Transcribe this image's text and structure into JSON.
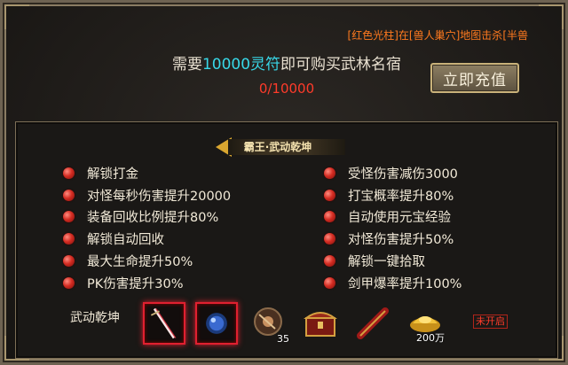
{
  "notice": {
    "item": "[红色光柱]",
    "text1": "在",
    "map": "[兽人巢穴]",
    "text2": "地图击杀",
    "boss": "[半兽"
  },
  "purchase": {
    "prefix": "需要",
    "amount": "10000灵符",
    "suffix": "即可购买武林名宿",
    "progress": "0/10000",
    "button_label": "立即充值"
  },
  "title": "霸王·武动乾坤",
  "benefits_left": [
    "解锁打金",
    "对怪每秒伤害提升20000",
    "装备回收比例提升80%",
    "解锁自动回收",
    "最大生命提升50%",
    "PK伤害提升30%"
  ],
  "benefits_right": [
    "受怪伤害减伤3000",
    "打宝概率提升80%",
    "自动使用元宝经验",
    "对怪伤害提升50%",
    "解锁一键拾取",
    "剑甲爆率提升100%"
  ],
  "set_label": "武动乾坤",
  "items": [
    {
      "icon": "sword-icon",
      "qty": ""
    },
    {
      "icon": "blue-orb-icon",
      "qty": ""
    },
    {
      "icon": "disc-icon",
      "qty": "35"
    },
    {
      "icon": "treasure-chest-icon",
      "qty": ""
    },
    {
      "icon": "scroll-icon",
      "qty": ""
    },
    {
      "icon": "gold-ingot-icon",
      "qty": "200万"
    }
  ],
  "status": "未开启",
  "colors": {
    "highlight": "#38d8e8",
    "progress": "#ff3b2a",
    "notice": "#ff7a1f",
    "bullet": "#d42c22"
  }
}
